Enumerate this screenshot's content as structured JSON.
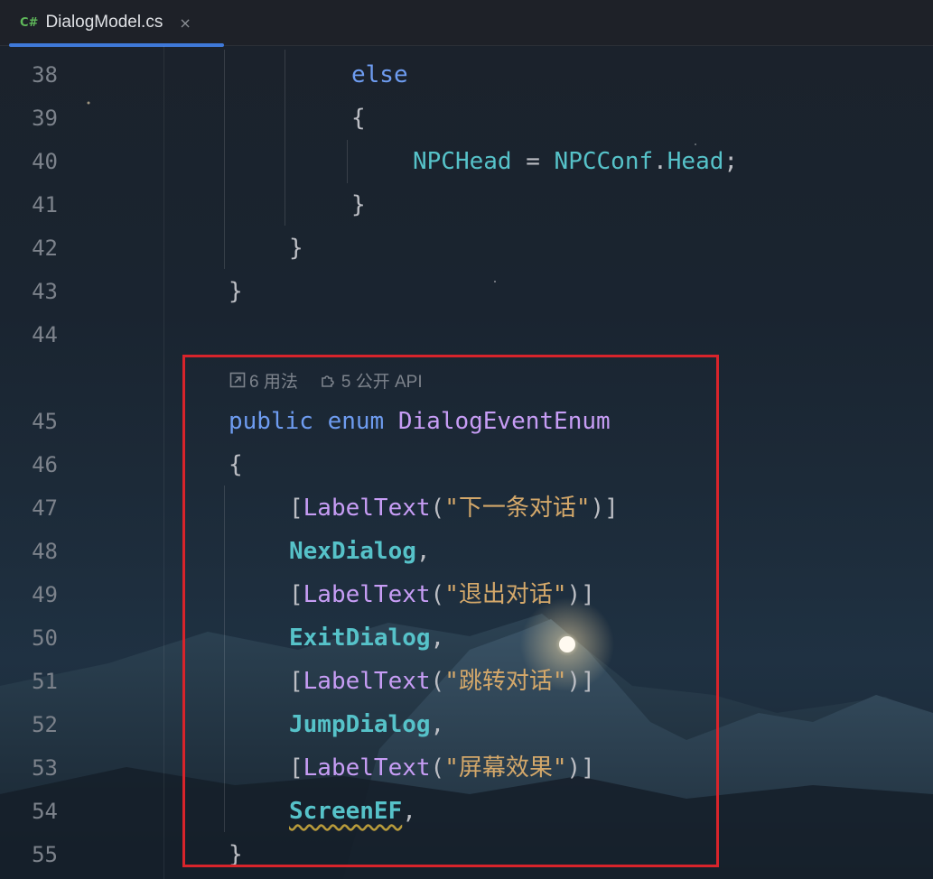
{
  "tab": {
    "language_badge": "C#",
    "file_name": "DialogModel.cs",
    "close_glyph": "×"
  },
  "inlay_hints": {
    "usages": "6 用法",
    "public_api": "5 公开 API"
  },
  "lines": [
    {
      "num": "38",
      "parts": [
        {
          "t": "else",
          "c": "kw"
        }
      ]
    },
    {
      "num": "39",
      "parts": [
        {
          "t": "{",
          "c": "punc"
        }
      ]
    },
    {
      "num": "40",
      "parts": [
        {
          "t": "NPCHead",
          "c": "field"
        },
        {
          "t": " = ",
          "c": "punc"
        },
        {
          "t": "NPCConf",
          "c": "field"
        },
        {
          "t": ".",
          "c": "punc"
        },
        {
          "t": "Head",
          "c": "field"
        },
        {
          "t": ";",
          "c": "punc"
        }
      ]
    },
    {
      "num": "41",
      "parts": [
        {
          "t": "}",
          "c": "punc"
        }
      ]
    },
    {
      "num": "42",
      "parts": [
        {
          "t": "}",
          "c": "punc"
        }
      ]
    },
    {
      "num": "43",
      "parts": [
        {
          "t": "}",
          "c": "punc"
        }
      ]
    },
    {
      "num": "44",
      "parts": []
    },
    {
      "num": "45",
      "parts": [
        {
          "t": "public",
          "c": "kw"
        },
        {
          "t": " ",
          "c": "punc"
        },
        {
          "t": "enum",
          "c": "kw"
        },
        {
          "t": " ",
          "c": "punc"
        },
        {
          "t": "DialogEventEnum",
          "c": "type"
        }
      ]
    },
    {
      "num": "46",
      "parts": [
        {
          "t": "{",
          "c": "punc"
        }
      ]
    },
    {
      "num": "47",
      "parts": [
        {
          "t": "[",
          "c": "punc"
        },
        {
          "t": "LabelText",
          "c": "attr"
        },
        {
          "t": "(",
          "c": "punc"
        },
        {
          "t": "\"下一条对话\"",
          "c": "str"
        },
        {
          "t": ")]",
          "c": "punc"
        }
      ]
    },
    {
      "num": "48",
      "parts": [
        {
          "t": "NexDialog",
          "c": "enumval"
        },
        {
          "t": ",",
          "c": "punc"
        }
      ]
    },
    {
      "num": "49",
      "parts": [
        {
          "t": "[",
          "c": "punc"
        },
        {
          "t": "LabelText",
          "c": "attr"
        },
        {
          "t": "(",
          "c": "punc"
        },
        {
          "t": "\"退出对话\"",
          "c": "str"
        },
        {
          "t": ")]",
          "c": "punc"
        }
      ]
    },
    {
      "num": "50",
      "parts": [
        {
          "t": "ExitDialog",
          "c": "enumval"
        },
        {
          "t": ",",
          "c": "punc"
        }
      ]
    },
    {
      "num": "51",
      "parts": [
        {
          "t": "[",
          "c": "punc"
        },
        {
          "t": "LabelText",
          "c": "attr"
        },
        {
          "t": "(",
          "c": "punc"
        },
        {
          "t": "\"跳转对话\"",
          "c": "str"
        },
        {
          "t": ")]",
          "c": "punc"
        }
      ]
    },
    {
      "num": "52",
      "parts": [
        {
          "t": "JumpDialog",
          "c": "enumval"
        },
        {
          "t": ",",
          "c": "punc"
        }
      ]
    },
    {
      "num": "53",
      "parts": [
        {
          "t": "[",
          "c": "punc"
        },
        {
          "t": "LabelText",
          "c": "attr"
        },
        {
          "t": "(",
          "c": "punc"
        },
        {
          "t": "\"屏幕效果\"",
          "c": "str"
        },
        {
          "t": ")]",
          "c": "punc"
        }
      ]
    },
    {
      "num": "54",
      "parts": [
        {
          "t": "ScreenEF",
          "c": "enumval squiggle"
        },
        {
          "t": ",",
          "c": "punc"
        }
      ]
    },
    {
      "num": "55",
      "parts": [
        {
          "t": "}",
          "c": "punc"
        }
      ]
    }
  ],
  "colors": {
    "keyword": "#6e9cf0",
    "type": "#c79df5",
    "field": "#56c2c9",
    "string": "#d4a86a",
    "highlight_border": "#d8242b",
    "active_tab_underline": "#3f79d9"
  }
}
